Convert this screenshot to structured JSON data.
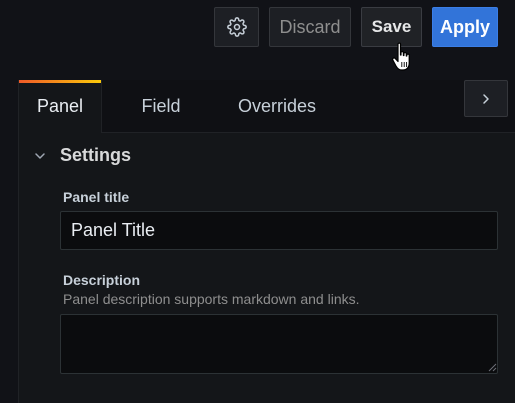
{
  "toolbar": {
    "settings_icon": "gear-icon",
    "discard_label": "Discard",
    "save_label": "Save",
    "apply_label": "Apply"
  },
  "tabs": [
    {
      "label": "Panel",
      "active": true
    },
    {
      "label": "Field",
      "active": false
    },
    {
      "label": "Overrides",
      "active": false
    }
  ],
  "collapse_icon": "chevron-right-icon",
  "settings": {
    "section_title": "Settings",
    "panel_title": {
      "label": "Panel title",
      "value": "Panel Title"
    },
    "description": {
      "label": "Description",
      "help": "Panel description supports markdown and links.",
      "value": ""
    }
  },
  "colors": {
    "background": "#111217",
    "apply_button": "#3274d9",
    "active_tab_gradient_start": "#f05a28",
    "active_tab_gradient_end": "#fbca0a"
  }
}
